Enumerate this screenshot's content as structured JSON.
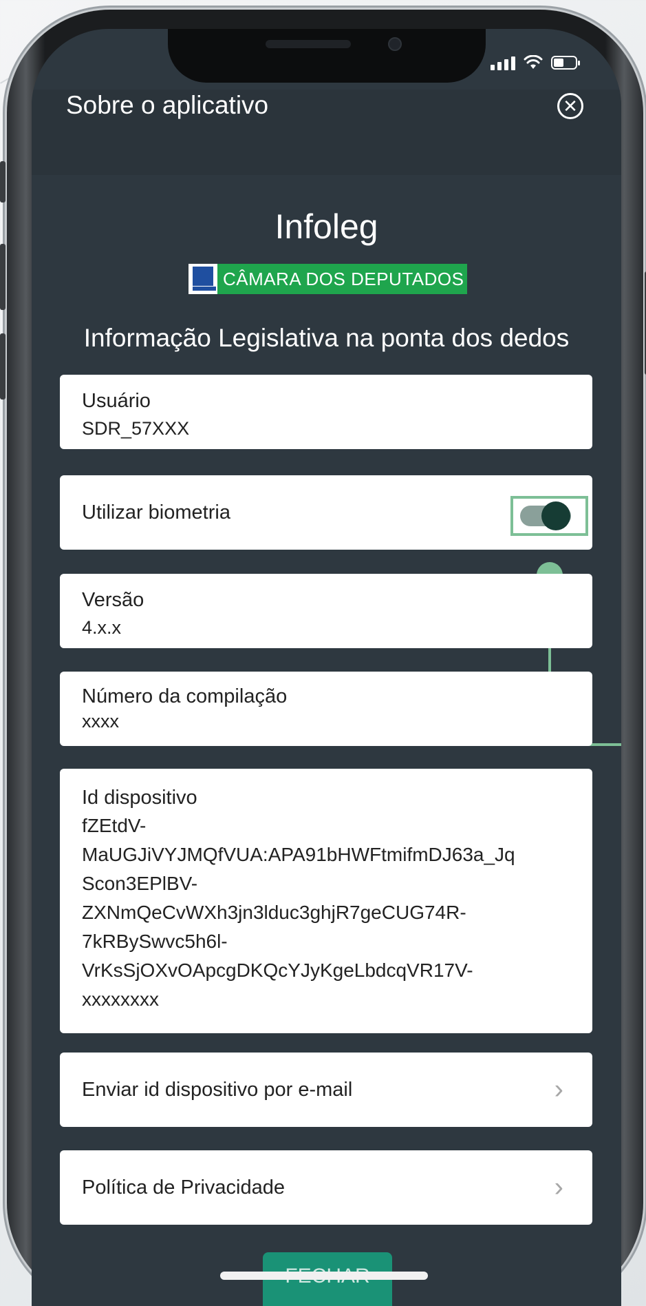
{
  "header": {
    "title": "Sobre o aplicativo",
    "close_icon": "close-circle-icon"
  },
  "app": {
    "name": "Infoleg",
    "logo_text": "CÂMARA DOS DEPUTADOS",
    "tagline": "Informação Legislativa na ponta dos dedos"
  },
  "fields": {
    "user": {
      "label": "Usuário",
      "value": "SDR_57XXX"
    },
    "biometrics": {
      "label": "Utilizar biometria",
      "enabled": true
    },
    "version": {
      "label": "Versão",
      "value": "4.x.x"
    },
    "build": {
      "label": "Número da compilação",
      "value": "xxxx"
    },
    "device_id": {
      "label": "Id dispositivo",
      "lines": [
        "fZEtdV-",
        "MaUGJiVYJMQfVUA:APA91bHWFtmifmDJ63a_Jq",
        "Scon3EPlBV-",
        "ZXNmQeCvWXh3jn3lduc3ghjR7geCUG74R-",
        "7kRBySwvc5h6l-",
        "VrKsSjOXvOApcgDKQcYJyKgeLbdcqVR17V-",
        "xxxxxxxx"
      ]
    }
  },
  "actions": {
    "email_device_id": "Enviar id dispositivo por e-mail",
    "privacy_policy": "Política de Privacidade",
    "close": "FECHAR"
  },
  "colors": {
    "background": "#2e3840",
    "highlight": "#7dbf96",
    "logo_green": "#1fa54d",
    "button": "#1a9276"
  }
}
